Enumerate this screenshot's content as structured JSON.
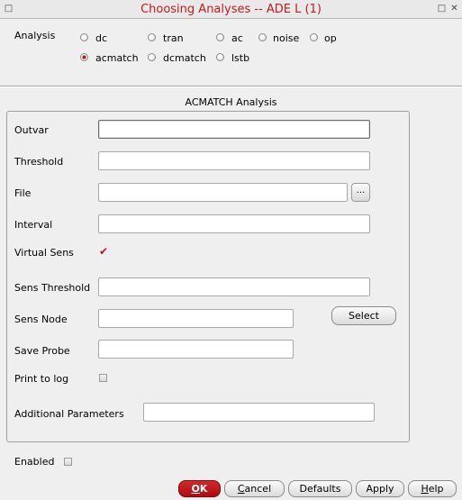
{
  "window": {
    "title": "Choosing Analyses -- ADE L (1)"
  },
  "analysis": {
    "label": "Analysis",
    "options": [
      "dc",
      "tran",
      "ac",
      "noise",
      "op",
      "acmatch",
      "dcmatch",
      "lstb"
    ],
    "selected": "acmatch"
  },
  "group": {
    "title": "ACMATCH Analysis",
    "outvar": {
      "label": "Outvar",
      "value": ""
    },
    "threshold": {
      "label": "Threshold",
      "value": ""
    },
    "file": {
      "label": "File",
      "value": "",
      "browse_label": "..."
    },
    "interval": {
      "label": "Interval",
      "value": ""
    },
    "virtual_sens": {
      "label": "Virtual Sens",
      "checked": true
    },
    "sens_threshold": {
      "label": "Sens Threshold",
      "value": ""
    },
    "sens_node": {
      "label": "Sens Node",
      "value": ""
    },
    "select_label": "Select",
    "save_probe": {
      "label": "Save Probe",
      "value": ""
    },
    "print_to_log": {
      "label": "Print to log",
      "checked": false
    },
    "additional_parameters": {
      "label": "Additional Parameters",
      "value": ""
    }
  },
  "enabled": {
    "label": "Enabled",
    "checked": false
  },
  "buttons": {
    "ok": {
      "mnemonic": "O",
      "rest": "K"
    },
    "cancel": {
      "mnemonic": "C",
      "rest": "ancel"
    },
    "defaults": "Defaults",
    "apply": {
      "mnemonic": "",
      "rest": "Apply"
    },
    "help": {
      "mnemonic": "H",
      "rest": "elp"
    }
  },
  "colors": {
    "accent": "#c21b1b",
    "ok_button": "#b81318"
  }
}
